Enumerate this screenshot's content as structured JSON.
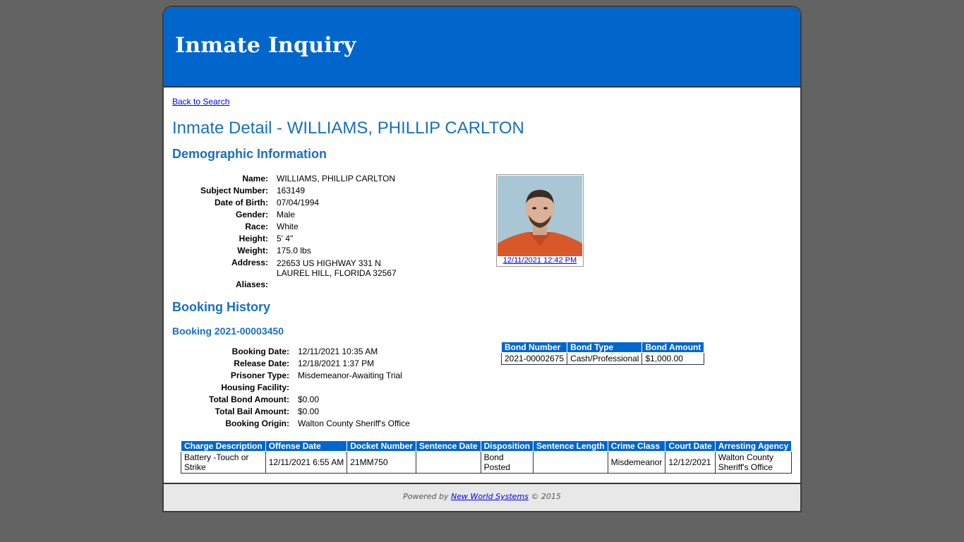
{
  "header": {
    "title": "Inmate Inquiry"
  },
  "back_link": "Back to Search",
  "detail_title": "Inmate Detail - WILLIAMS, PHILLIP CARLTON",
  "demographics": {
    "heading": "Demographic Information",
    "fields": [
      {
        "label": "Name:",
        "value": "WILLIAMS, PHILLIP CARLTON"
      },
      {
        "label": "Subject Number:",
        "value": "163149"
      },
      {
        "label": "Date of Birth:",
        "value": "07/04/1994"
      },
      {
        "label": "Gender:",
        "value": "Male"
      },
      {
        "label": "Race:",
        "value": "White"
      },
      {
        "label": "Height:",
        "value": "5' 4\""
      },
      {
        "label": "Weight:",
        "value": "175.0 lbs"
      },
      {
        "label": "Address:",
        "value": "22653 US HIGHWAY 331 N\nLAUREL HILL, FLORIDA 32567"
      },
      {
        "label": "Aliases:",
        "value": ""
      }
    ],
    "photo_caption": "12/11/2021 12:42 PM"
  },
  "booking_history": {
    "heading": "Booking History",
    "booking_title": "Booking 2021-00003450",
    "fields": [
      {
        "label": "Booking Date:",
        "value": "12/11/2021 10:35 AM"
      },
      {
        "label": "Release Date:",
        "value": "12/18/2021 1:37 PM"
      },
      {
        "label": "Prisoner Type:",
        "value": "Misdemeanor-Awaiting Trial"
      },
      {
        "label": "Housing Facility:",
        "value": ""
      },
      {
        "label": "Total Bond Amount:",
        "value": "$0.00"
      },
      {
        "label": "Total Bail Amount:",
        "value": "$0.00"
      },
      {
        "label": "Booking Origin:",
        "value": "Walton County Sheriff's Office"
      }
    ],
    "bond_table": {
      "headers": [
        "Bond Number",
        "Bond Type",
        "Bond Amount"
      ],
      "rows": [
        [
          "2021-00002675",
          "Cash/Professional",
          "$1,000.00"
        ]
      ]
    },
    "charge_table": {
      "headers": [
        "Charge Description",
        "Offense Date",
        "Docket Number",
        "Sentence Date",
        "Disposition",
        "Sentence Length",
        "Crime Class",
        "Court Date",
        "Arresting Agency"
      ],
      "rows": [
        [
          "Battery -Touch or Strike",
          "12/11/2021 6:55 AM",
          "21MM750",
          "",
          "Bond Posted",
          "",
          "Misdemeanor",
          "12/12/2021",
          "Walton County Sheriff's Office"
        ]
      ]
    }
  },
  "footer": {
    "prefix": "Powered by",
    "link": "New World Systems",
    "suffix": "© 2015"
  },
  "colors": {
    "header_bg": "#0066cc",
    "title_blue": "#1a6fbf",
    "page_bg": "#636363"
  },
  "icons": [
    "inmate-photo"
  ]
}
